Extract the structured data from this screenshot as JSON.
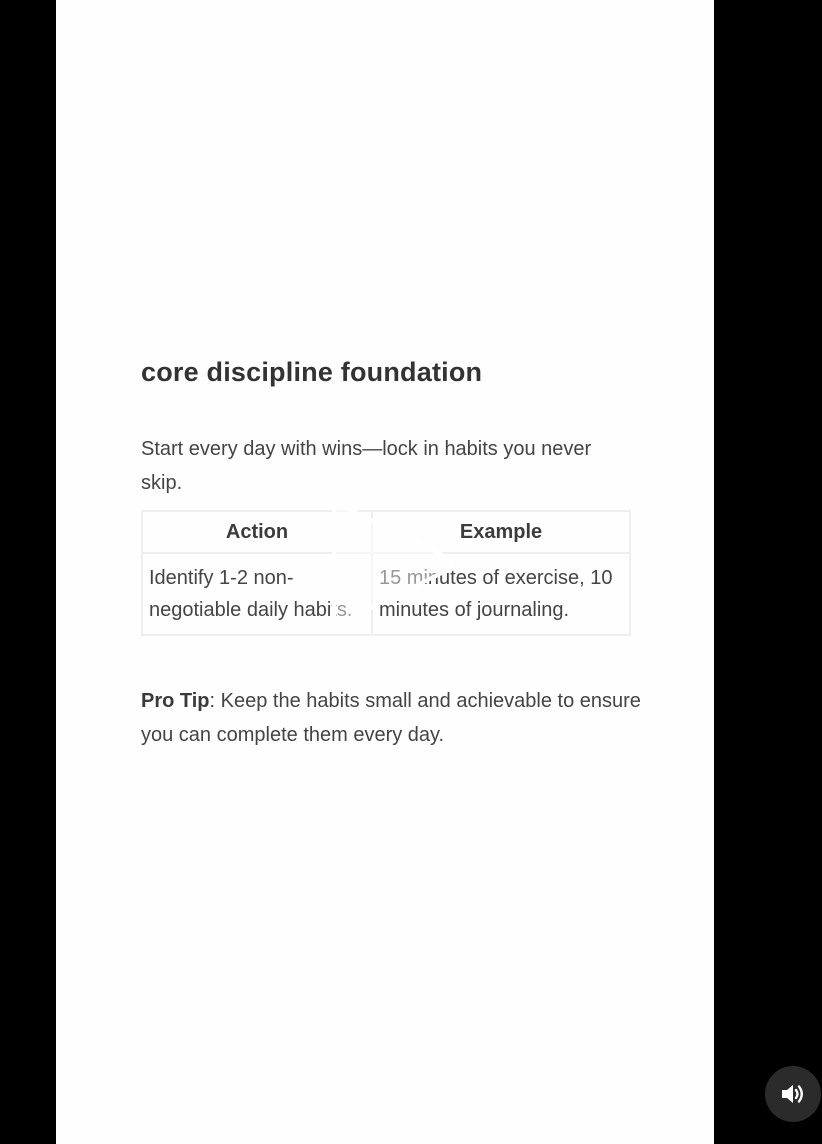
{
  "post": {
    "title": "core discipline foundation",
    "intro": "Start every day with wins—lock in habits you never skip.",
    "table": {
      "headers": [
        "Action",
        "Example"
      ],
      "rows": [
        [
          "Identify 1-2 non-negotiable daily habits.",
          "15 minutes of exercise, 10 minutes of journaling."
        ]
      ]
    },
    "tip": {
      "label": "Pro Tip",
      "text": ": Keep the habits small and achievable to ensure you can complete them every day."
    }
  },
  "controls": {
    "play_icon": "play-icon",
    "sound_icon": "speaker-on-icon"
  },
  "colors": {
    "frame_background": "#fefefe",
    "player_background": "#000000",
    "sound_button_background": "#2b2b2b",
    "text": "#444444"
  }
}
